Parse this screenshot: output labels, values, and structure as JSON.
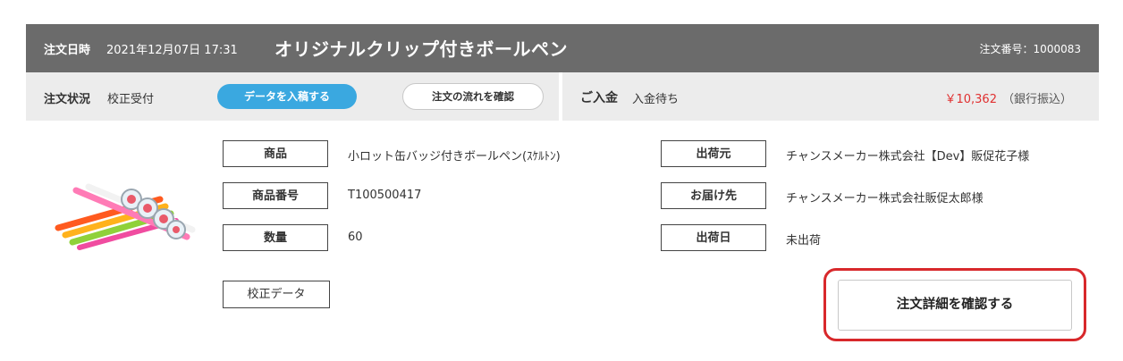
{
  "header": {
    "order_date_label": "注文日時",
    "order_date_value": "2021年12月07日 17:31",
    "product_title": "オリジナルクリップ付きボールペン",
    "order_number": "注文番号：1000083"
  },
  "status": {
    "label": "注文状況",
    "value": "校正受付",
    "upload_button": "データを入稿する",
    "flow_button": "注文の流れを確認"
  },
  "payment": {
    "label": "ご入金",
    "value": "入金待ち",
    "amount": "￥10,362",
    "method": "（銀行振込）"
  },
  "details": {
    "product_label": "商品",
    "product_value": "小ロット缶バッジ付きボールペン(ｽｹﾙﾄﾝ)",
    "product_no_label": "商品番号",
    "product_no_value": "T100500417",
    "quantity_label": "数量",
    "quantity_value": "60",
    "ship_from_label": "出荷元",
    "ship_from_value": "チャンスメーカー株式会社【Dev】販促花子様",
    "deliver_to_label": "お届け先",
    "deliver_to_value": "チャンスメーカー株式会社販促太郎様",
    "ship_date_label": "出荷日",
    "ship_date_value": "未出荷"
  },
  "actions": {
    "proof_data": "校正データ",
    "order_detail_button": "注文詳細を確認する"
  },
  "colors": {
    "header_bg": "#6b6b6b",
    "status_bg": "#ececec",
    "accent_blue": "#3aa8e0",
    "price_red": "#e03030",
    "highlight_red": "#d8282b"
  }
}
